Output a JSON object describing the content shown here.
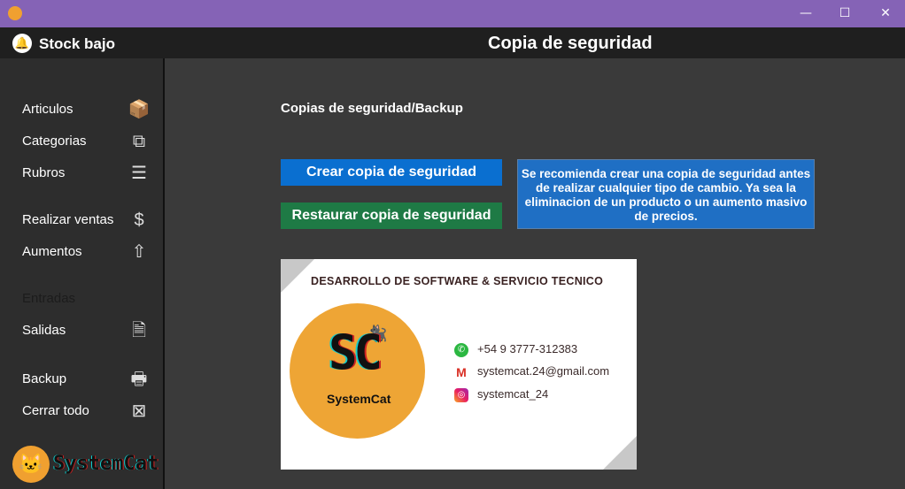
{
  "window": {
    "minimize": "—",
    "maximize": "☐",
    "close": "✕"
  },
  "header": {
    "stock_label": "Stock bajo",
    "page_title": "Copia de seguridad"
  },
  "sidebar": {
    "items": [
      {
        "label": "Articulos",
        "icon": "📦"
      },
      {
        "label": "Categorias",
        "icon": "⧉"
      },
      {
        "label": "Rubros",
        "icon": "☰"
      },
      {
        "label": "Realizar ventas",
        "icon": "$"
      },
      {
        "label": "Aumentos",
        "icon": "⇧"
      },
      {
        "label": "Entradas",
        "icon": ""
      },
      {
        "label": "Salidas",
        "icon": "🗎"
      },
      {
        "label": "Backup",
        "icon": "🖶"
      },
      {
        "label": "Cerrar todo",
        "icon": "⊠"
      }
    ],
    "logo_text": "SystemCat"
  },
  "main": {
    "section_title": "Copias de seguridad/Backup",
    "create_label": "Crear copia de seguridad",
    "restore_label": "Restaurar copia de seguridad",
    "info_text": "Se recomienda crear una copia de seguridad antes de realizar cualquier tipo de cambio. Ya sea la eliminacion de un producto o un aumento masivo de precios.",
    "colors": {
      "create": "#0a6fd0",
      "restore": "#1e7a45",
      "info": "#1f6fc4"
    }
  },
  "card": {
    "title": "DESARROLLO DE SOFTWARE  &  SERVICIO TECNICO",
    "logo_initials": "SC",
    "logo_name": "SystemCat",
    "phone": "+54 9 3777-312383",
    "email": "systemcat.24@gmail.com",
    "instagram": "systemcat_24"
  }
}
